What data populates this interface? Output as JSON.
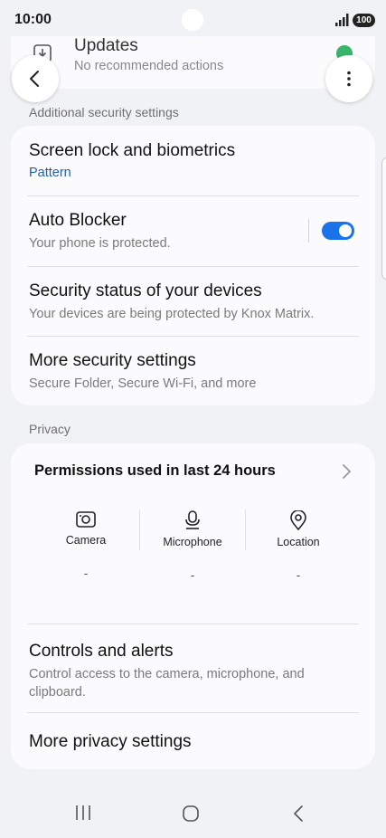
{
  "status_bar": {
    "time": "10:00",
    "battery": "100"
  },
  "updates": {
    "title": "Updates",
    "subtitle": "No recommended actions"
  },
  "sections": {
    "security_header": "Additional security settings",
    "privacy_header": "Privacy"
  },
  "security_items": [
    {
      "title": "Screen lock and biometrics",
      "subtitle": "Pattern"
    },
    {
      "title": "Auto Blocker",
      "subtitle": "Your phone is protected.",
      "toggle_on": true
    },
    {
      "title": "Security status of your devices",
      "subtitle": "Your devices are being protected by Knox Matrix."
    },
    {
      "title": "More security settings",
      "subtitle": "Secure Folder, Secure Wi-Fi, and more"
    }
  ],
  "permissions": {
    "title": "Permissions used in last 24 hours",
    "items": [
      {
        "label": "Camera",
        "value": "-",
        "icon": "camera-icon"
      },
      {
        "label": "Microphone",
        "value": "-",
        "icon": "microphone-icon"
      },
      {
        "label": "Location",
        "value": "-",
        "icon": "location-icon"
      }
    ]
  },
  "privacy_items": [
    {
      "title": "Controls and alerts",
      "subtitle": "Control access to the camera, microphone, and clipboard."
    },
    {
      "title": "More privacy settings"
    }
  ],
  "colors": {
    "accent": "#1a73e8",
    "link": "#1a5fb4",
    "background": "#f1f2f5",
    "card": "#fbfbfd",
    "check": "#38b56a"
  }
}
